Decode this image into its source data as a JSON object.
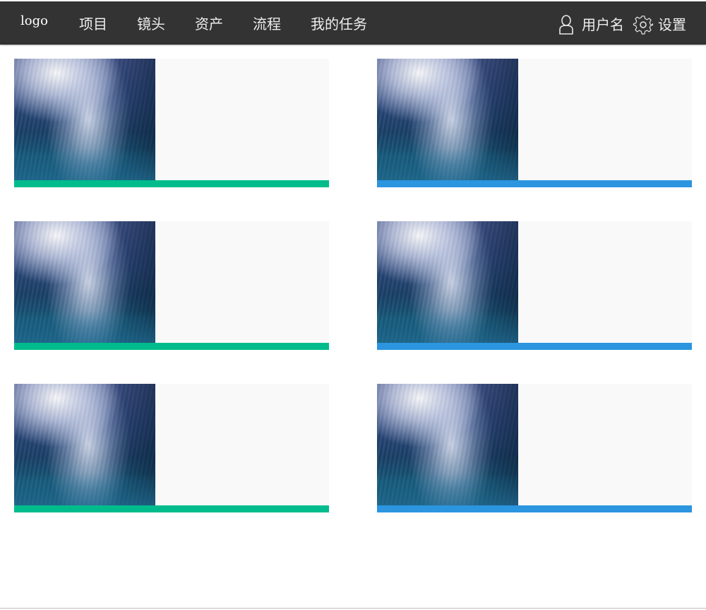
{
  "header": {
    "logo": "logo",
    "nav": [
      "项目",
      "镜头",
      "资产",
      "流程",
      "我的任务"
    ],
    "username": "用户名",
    "settings": "设置",
    "icons": {
      "user": "user-icon",
      "settings": "gear-icon"
    }
  },
  "cards": [
    {
      "image": "underwater-wave-thumbnail",
      "status_color": "#00bc8c"
    },
    {
      "image": "underwater-wave-thumbnail",
      "status_color": "#2b95e0"
    },
    {
      "image": "underwater-wave-thumbnail",
      "status_color": "#00bc8c"
    },
    {
      "image": "underwater-wave-thumbnail",
      "status_color": "#2b95e0"
    },
    {
      "image": "underwater-wave-thumbnail",
      "status_color": "#00bc8c"
    },
    {
      "image": "underwater-wave-thumbnail",
      "status_color": "#2b95e0"
    }
  ],
  "colors": {
    "topbar": "#333333",
    "card_background": "#f9f9f9",
    "green": "#00bc8c",
    "blue": "#2b95e0"
  }
}
